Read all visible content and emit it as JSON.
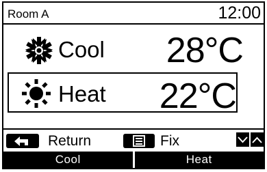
{
  "header": {
    "room": "Room A",
    "time": "12:00"
  },
  "modes": [
    {
      "label": "Cool",
      "icon": "snowflake-icon",
      "temp_value": "28",
      "temp_unit": "°C",
      "selected": false
    },
    {
      "label": "Heat",
      "icon": "sun-icon",
      "temp_value": "22",
      "temp_unit": "°C",
      "selected": true
    }
  ],
  "footer": {
    "return_label": "Return",
    "fix_label": "Fix",
    "return_icon": "return-arrow-icon",
    "fix_icon": "list-icon",
    "down_icon": "chevron-down-icon",
    "up_icon": "chevron-up-icon"
  },
  "softkeys": {
    "left": "Cool",
    "right": "Heat"
  }
}
